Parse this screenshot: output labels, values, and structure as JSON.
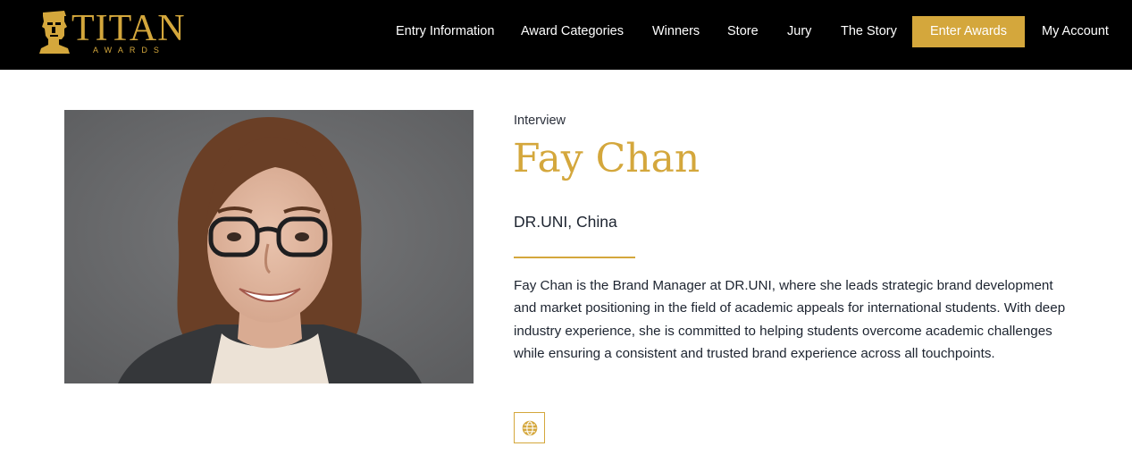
{
  "brand": {
    "name": "TITAN",
    "sub": "AWARDS",
    "accent_color": "#d4a73c"
  },
  "nav": {
    "items": [
      {
        "label": "Entry Information"
      },
      {
        "label": "Award Categories"
      },
      {
        "label": "Winners"
      },
      {
        "label": "Store"
      },
      {
        "label": "Jury"
      },
      {
        "label": "The Story"
      }
    ],
    "cta_label": "Enter Awards",
    "account_label": "My Account"
  },
  "profile": {
    "eyebrow": "Interview",
    "name": "Fay Chan",
    "company": "DR.UNI, China",
    "bio": "Fay Chan is the Brand Manager at DR.UNI, where she leads strategic brand development and market positioning in the field of academic appeals for international students. With deep industry experience, she is committed to helping students overcome academic challenges while ensuring a consistent and trusted brand experience across all touchpoints.",
    "website_icon": "globe-icon"
  }
}
